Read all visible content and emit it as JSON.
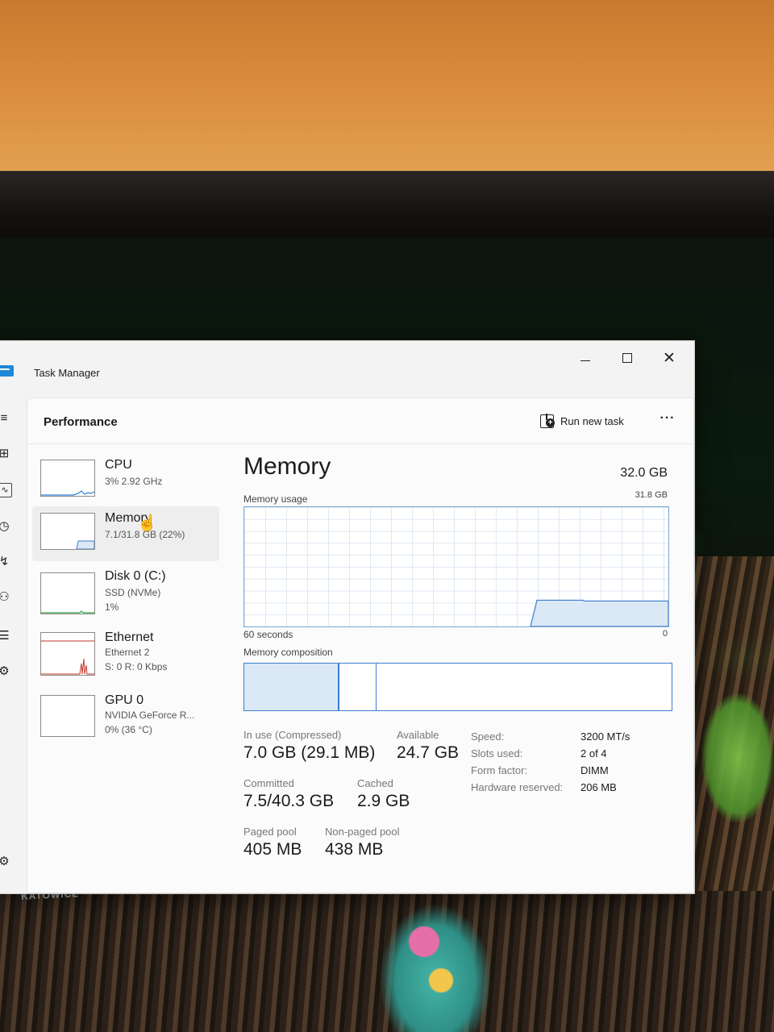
{
  "window": {
    "title": "Task Manager",
    "page_title": "Performance",
    "run_new_task_label": "Run new task",
    "more_label": "···",
    "close_label": "✕"
  },
  "devices": [
    {
      "name": "CPU",
      "sub1": "3% 2.92 GHz",
      "sub2": ""
    },
    {
      "name": "Memory",
      "sub1": "7.1/31.8 GB (22%)",
      "sub2": ""
    },
    {
      "name": "Disk 0 (C:)",
      "sub1": "SSD (NVMe)",
      "sub2": "1%"
    },
    {
      "name": "Ethernet",
      "sub1": "Ethernet 2",
      "sub2": "S: 0 R: 0 Kbps"
    },
    {
      "name": "GPU 0",
      "sub1": "NVIDIA GeForce R...",
      "sub2": "0% (36 °C)"
    }
  ],
  "memory": {
    "title": "Memory",
    "total": "32.0 GB",
    "usage_label": "Memory usage",
    "usage_max": "31.8 GB",
    "axis_left": "60 seconds",
    "axis_right": "0",
    "composition_label": "Memory composition",
    "usage_fraction_recent": 0.22,
    "composition": {
      "in_use_fraction": 0.22,
      "modified_fraction": 0.002,
      "standby_fraction": 0.087,
      "free_fraction": 0.691
    }
  },
  "stats": {
    "in_use_label": "In use (Compressed)",
    "in_use_value": "7.0 GB (29.1 MB)",
    "available_label": "Available",
    "available_value": "24.7 GB",
    "committed_label": "Committed",
    "committed_value": "7.5/40.3 GB",
    "cached_label": "Cached",
    "cached_value": "2.9 GB",
    "paged_label": "Paged pool",
    "paged_value": "405 MB",
    "nonpaged_label": "Non-paged pool",
    "nonpaged_value": "438 MB"
  },
  "specs": {
    "speed_label": "Speed:",
    "speed_value": "3200 MT/s",
    "slots_label": "Slots used:",
    "slots_value": "2 of 4",
    "form_label": "Form factor:",
    "form_value": "DIMM",
    "hw_label": "Hardware reserved:",
    "hw_value": "206 MB"
  },
  "colors": {
    "accent": "#3c7ccf",
    "fill": "#dbe8f6"
  },
  "background_text": "KATOWICE"
}
